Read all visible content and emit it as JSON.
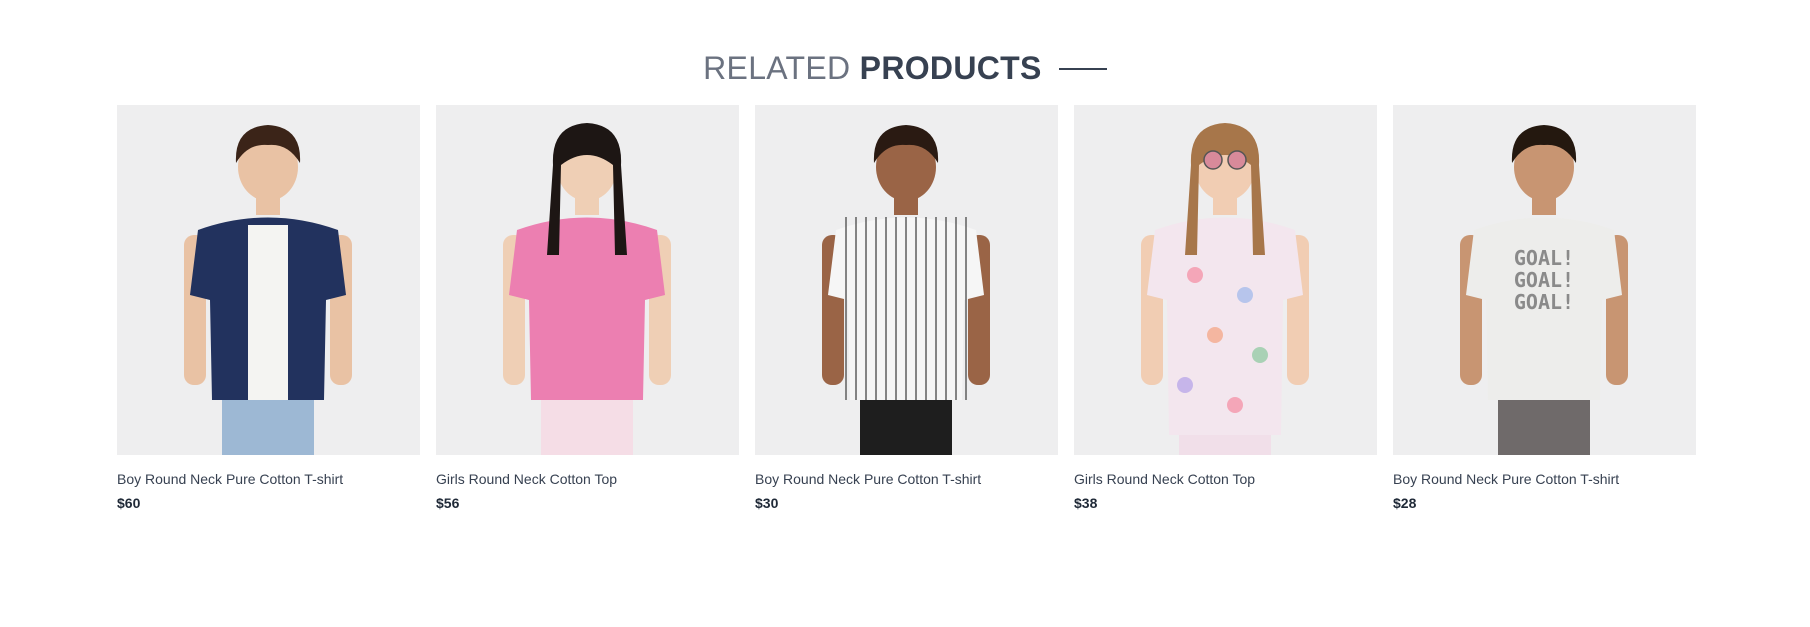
{
  "section": {
    "heading_light": "RELATED",
    "heading_bold": "PRODUCTS"
  },
  "products": [
    {
      "name": "Boy Round Neck Pure Cotton T-shirt",
      "price": "$60",
      "image": "boy-navy-shirt-photo",
      "colors": {
        "hair": "#3b2418",
        "skin": "#e9c2a4",
        "top": "#22325e",
        "inner": "#f4f4f2",
        "bottom": "#9db8d4"
      }
    },
    {
      "name": "Girls Round Neck Cotton Top",
      "price": "$56",
      "image": "girl-pink-top-photo",
      "colors": {
        "hair": "#1d1614",
        "skin": "#efcfb5",
        "top": "#ec7fb1",
        "inner": "#ec7fb1",
        "bottom": "#f5dde6"
      }
    },
    {
      "name": "Boy Round Neck Pure Cotton T-shirt",
      "price": "$30",
      "image": "boy-striped-jersey-photo",
      "colors": {
        "hair": "#2a1a12",
        "skin": "#9a6446",
        "top": "#f6f6f6",
        "inner": "#f6f6f6",
        "bottom": "#1e1e1e"
      }
    },
    {
      "name": "Girls Round Neck Cotton Top",
      "price": "$38",
      "image": "girl-floral-dress-photo",
      "colors": {
        "hair": "#a7764a",
        "skin": "#f1cdb3",
        "top": "#f3e6ee",
        "inner": "#f3e6ee",
        "bottom": "#f1dfe9"
      }
    },
    {
      "name": "Boy Round Neck Pure Cotton T-shirt",
      "price": "$28",
      "image": "boy-goal-tee-photo",
      "colors": {
        "hair": "#24180f",
        "skin": "#c89572",
        "top": "#ededeb",
        "inner": "#ededeb",
        "bottom": "#6f6a6a"
      }
    }
  ]
}
